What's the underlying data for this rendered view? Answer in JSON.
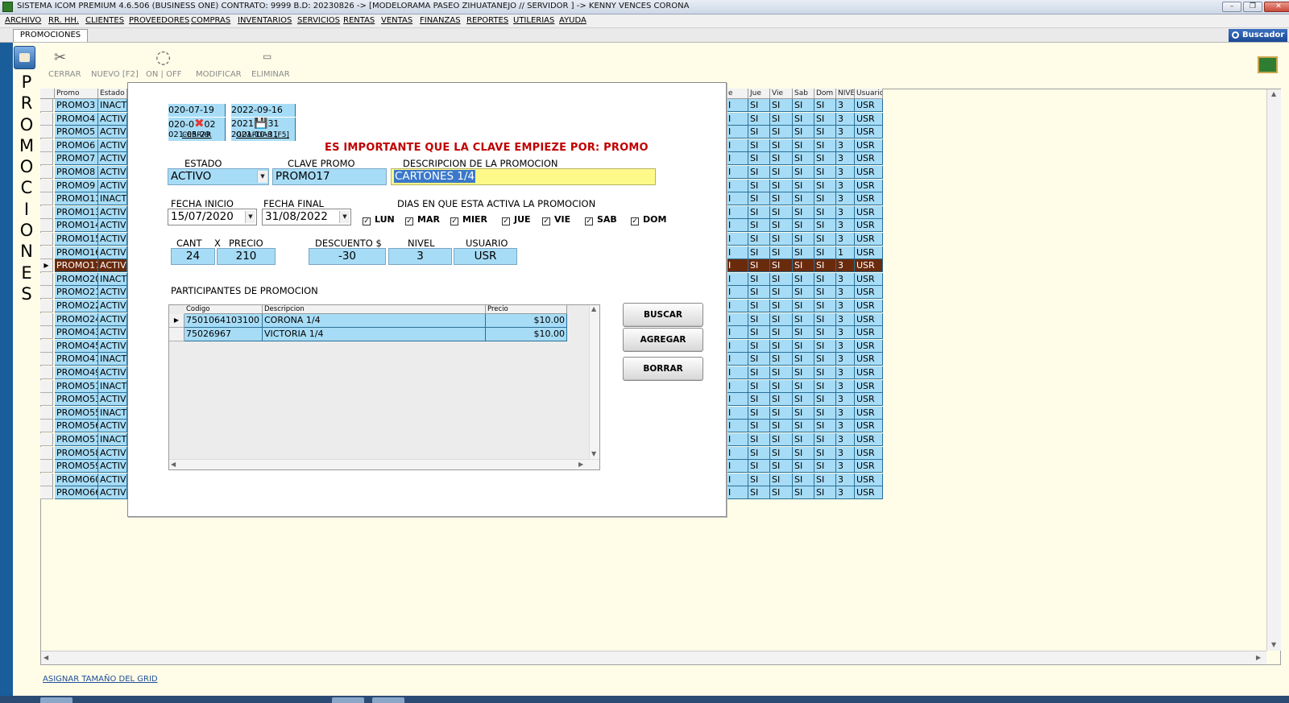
{
  "window": {
    "title": "SISTEMA ICOM PREMIUM 4.6.506 (BUSINESS ONE)  CONTRATO: 9999  B.D: 20230826  ->  [MODELORAMA PASEO ZIHUATANEJO // SERVIDOR ]  ->  KENNY VENCES CORONA"
  },
  "menu": [
    "ARCHIVO",
    "RR. HH.",
    "CLIENTES",
    "PROVEEDORES",
    "COMPRAS",
    "INVENTARIOS",
    "SERVICIOS",
    "RENTAS",
    "VENTAS",
    "FINANZAS",
    "REPORTES",
    "UTILERIAS",
    "AYUDA"
  ],
  "tab": {
    "label": "PROMOCIONES"
  },
  "buscador": "Buscador",
  "side_title": [
    "P",
    "R",
    "O",
    "M",
    "O",
    "C",
    "I",
    "O",
    "N",
    "E",
    "S"
  ],
  "toolbar": {
    "cerrar": "CERRAR",
    "nuevo": "NUEVO [F2]",
    "onoff": "ON  |  OFF",
    "modificar": "MODIFICAR",
    "eliminar": "ELIMINAR"
  },
  "grid": {
    "headers_left": [
      "Promo",
      "Estado"
    ],
    "headers_right": [
      "e",
      "Jue",
      "Vie",
      "Sab",
      "Dom",
      "NIVEL",
      "Usuario"
    ],
    "rows": [
      {
        "promo": "PROMO3",
        "estado": "INACT",
        "nivel": "3"
      },
      {
        "promo": "PROMO4",
        "estado": "ACTIV",
        "nivel": "3"
      },
      {
        "promo": "PROMO5",
        "estado": "ACTIV",
        "nivel": "3"
      },
      {
        "promo": "PROMO6",
        "estado": "ACTIV",
        "nivel": "3"
      },
      {
        "promo": "PROMO7",
        "estado": "ACTIV",
        "nivel": "3"
      },
      {
        "promo": "PROMO8",
        "estado": "ACTIV",
        "nivel": "3"
      },
      {
        "promo": "PROMO9",
        "estado": "ACTIV",
        "nivel": "3"
      },
      {
        "promo": "PROMO11",
        "estado": "INACT",
        "nivel": "3"
      },
      {
        "promo": "PROMO13",
        "estado": "ACTIV",
        "nivel": "3"
      },
      {
        "promo": "PROMO14",
        "estado": "ACTIV",
        "nivel": "3"
      },
      {
        "promo": "PROMO15",
        "estado": "ACTIV",
        "nivel": "3"
      },
      {
        "promo": "PROMO16",
        "estado": "ACTIV",
        "nivel": "1"
      },
      {
        "promo": "PROMO17",
        "estado": "ACTIV",
        "nivel": "3",
        "selected": true
      },
      {
        "promo": "PROMO20",
        "estado": "INACT",
        "nivel": "3"
      },
      {
        "promo": "PROMO21",
        "estado": "ACTIV",
        "nivel": "3"
      },
      {
        "promo": "PROMO22",
        "estado": "ACTIV",
        "nivel": "3"
      },
      {
        "promo": "PROMO24",
        "estado": "ACTIV",
        "nivel": "3"
      },
      {
        "promo": "PROMO43",
        "estado": "ACTIV",
        "nivel": "3"
      },
      {
        "promo": "PROMO45",
        "estado": "ACTIV",
        "nivel": "3"
      },
      {
        "promo": "PROMO47",
        "estado": "INACT",
        "nivel": "3"
      },
      {
        "promo": "PROMO49",
        "estado": "ACTIV",
        "nivel": "3"
      },
      {
        "promo": "PROMO51",
        "estado": "INACT",
        "nivel": "3"
      },
      {
        "promo": "PROMO53",
        "estado": "ACTIV",
        "nivel": "3"
      },
      {
        "promo": "PROMO55",
        "estado": "INACT",
        "nivel": "3"
      },
      {
        "promo": "PROMO56",
        "estado": "ACTIV",
        "nivel": "3"
      },
      {
        "promo": "PROMO57",
        "estado": "INACT",
        "nivel": "3"
      },
      {
        "promo": "PROMO58",
        "estado": "ACTIV",
        "nivel": "3"
      },
      {
        "promo": "PROMO59",
        "estado": "ACTIV",
        "nivel": "3"
      },
      {
        "promo": "PROMO60",
        "estado": "ACTIV",
        "nivel": "3"
      },
      {
        "promo": "PROMO66",
        "estado": "ACTIV",
        "nivel": "3"
      }
    ],
    "day_value": "SI",
    "user_value": "USR",
    "day_value_partial": "I"
  },
  "grid_link": "ASIGNAR TAMAÑO DEL GRID",
  "modal": {
    "peek": {
      "r1c1": "020-07-19",
      "r1c2": "2022-09-16",
      "r2c1": "020-0",
      "r2c1b": "02",
      "r2c2": "2021",
      "r2c2b": "31",
      "r3c1": "021-05-29",
      "r3c2": "2021-10-31",
      "cerrar": "CERRAR",
      "guardar": "GUARDAR [F5]"
    },
    "warning": "ES IMPORTANTE QUE LA CLAVE EMPIEZE POR: PROMO",
    "labels": {
      "estado": "ESTADO",
      "clave": "CLAVE PROMO",
      "descripcion": "DESCRIPCION DE LA PROMOCION",
      "fecha_inicio": "FECHA INICIO",
      "fecha_final": "FECHA FINAL",
      "dias": "DIAS EN QUE ESTA ACTIVA LA PROMOCION",
      "cant": "CANT",
      "x": "X",
      "precio": "PRECIO",
      "descuento": "DESCUENTO $",
      "nivel": "NIVEL",
      "usuario": "USUARIO",
      "participantes": "PARTICIPANTES DE PROMOCION"
    },
    "values": {
      "estado": "ACTIVO",
      "clave": "PROMO17",
      "descripcion": "CARTONES 1/4",
      "fecha_inicio": "15/07/2020",
      "fecha_final": "31/08/2022",
      "cant": "24",
      "precio": "210",
      "descuento": "-30",
      "nivel": "3",
      "usuario": "USR"
    },
    "days": [
      {
        "label": "LUN",
        "checked": true
      },
      {
        "label": "MAR",
        "checked": true
      },
      {
        "label": "MIER",
        "checked": true
      },
      {
        "label": "JUE",
        "checked": true
      },
      {
        "label": "VIE",
        "checked": true
      },
      {
        "label": "SAB",
        "checked": true
      },
      {
        "label": "DOM",
        "checked": true
      }
    ],
    "participants": {
      "headers": [
        "Codigo",
        "Descripcion",
        "Precio"
      ],
      "rows": [
        {
          "codigo": "7501064103100",
          "descripcion": "CORONA 1/4",
          "precio": "$10.00"
        },
        {
          "codigo": "75026967",
          "descripcion": "VICTORIA 1/4",
          "precio": "$10.00"
        }
      ]
    },
    "buttons": {
      "buscar": "BUSCAR",
      "agregar": "AGREGAR",
      "borrar": "BORRAR"
    }
  }
}
